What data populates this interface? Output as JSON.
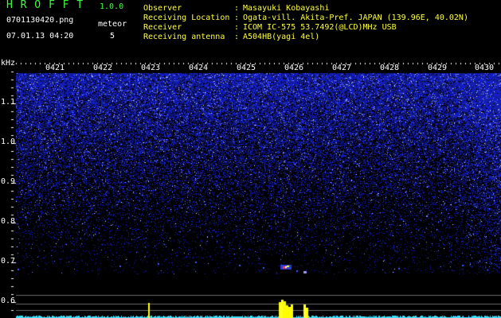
{
  "app": {
    "title": "H R O F F T",
    "version": "1.0.0"
  },
  "file": {
    "name": "0701130420.png",
    "datetime": "07.01.13 04:20"
  },
  "meteor": {
    "label": "meteor",
    "count": "5"
  },
  "info": [
    {
      "key": "Observer",
      "sep": ":",
      "value": "Masayuki Kobayashi"
    },
    {
      "key": "Receiving Location",
      "sep": ":",
      "value": "Ogata-vill. Akita-Pref. JAPAN (139.96E, 40.02N)"
    },
    {
      "key": "Receiver",
      "sep": ":",
      "value": "ICOM IC-575 53.7492(@LCD)MHz USB"
    },
    {
      "key": "Receiving antenna",
      "sep": ":",
      "value": "A504HB(yagi 4el)"
    }
  ],
  "axis": {
    "unit": "kHz",
    "y_labels": [
      "1.1",
      "1.0",
      "0.9",
      "0.8",
      "0.7",
      "0.6"
    ],
    "time_labels": [
      "0421",
      "0422",
      "0423",
      "0424",
      "0425",
      "0426",
      "0427",
      "0428",
      "0429",
      "0430"
    ]
  },
  "colors": {
    "background": "#000000",
    "noise_blue": "#2a3cff",
    "header_green": "#3cff3c",
    "header_yellow": "#ffff3c",
    "meteor_echo_yellow": "#ffff00",
    "trace_cyan": "#40e0ff"
  }
}
